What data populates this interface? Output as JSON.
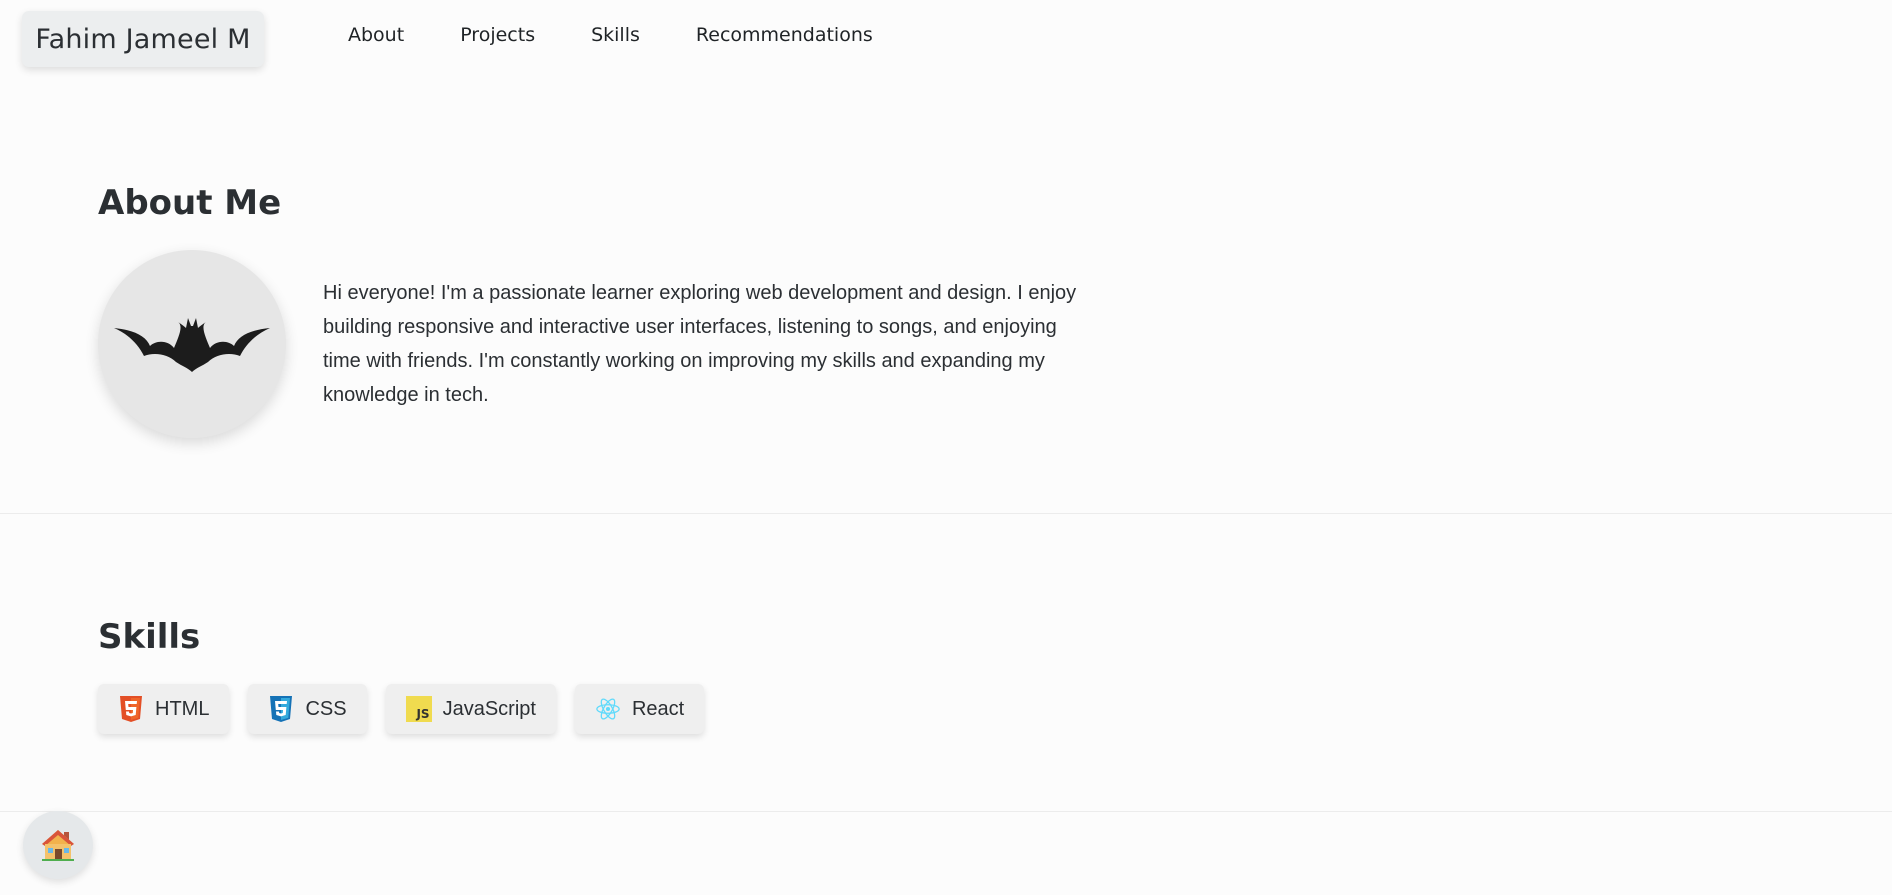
{
  "header": {
    "brand": "Fahim Jameel M",
    "nav": [
      {
        "label": "About"
      },
      {
        "label": "Projects"
      },
      {
        "label": "Skills"
      },
      {
        "label": "Recommendations"
      }
    ]
  },
  "about": {
    "title": "About Me",
    "avatar_icon": "bat-logo-icon",
    "text": "Hi everyone! I'm a passionate learner exploring web development and design. I enjoy building responsive and interactive user interfaces, listening to songs, and enjoying time with friends. I'm constantly working on improving my skills and expanding my knowledge in tech."
  },
  "skills": {
    "title": "Skills",
    "items": [
      {
        "label": "HTML",
        "icon": "html5-icon"
      },
      {
        "label": "CSS",
        "icon": "css3-icon"
      },
      {
        "label": "JavaScript",
        "icon": "javascript-icon",
        "badge": "JS"
      },
      {
        "label": "React",
        "icon": "react-icon"
      }
    ]
  },
  "home_button": {
    "icon": "house-icon"
  },
  "colors": {
    "background": "#fcfcfc",
    "text": "#2b2f33",
    "html": "#e34f26",
    "css": "#1572b6",
    "js": "#f0db4f",
    "react": "#61dafb"
  }
}
